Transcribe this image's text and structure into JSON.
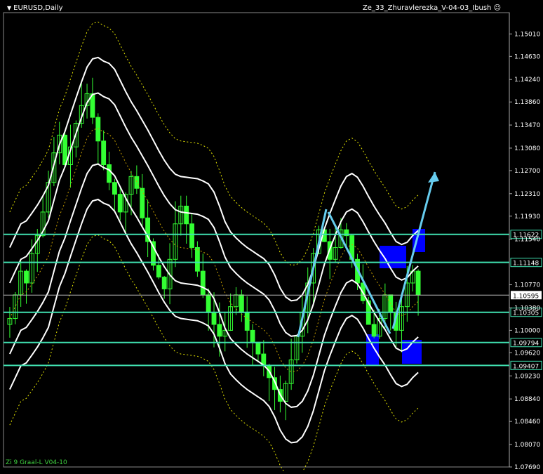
{
  "header": {
    "symbol": "EURUSD,Daily",
    "indicator_name": "Ze_33_Zhuravlerezka_V-04-03_Ibush"
  },
  "footer": {
    "label": "Zi 9 Graal-L V04-10"
  },
  "colors": {
    "background": "#000000",
    "candles": "#33ff33",
    "bands": "#ffffff",
    "level_lines": "#40e0b0",
    "arrows": "#66ccee",
    "zones": "#0000ff",
    "dotted_ma": "#e6e600"
  },
  "chart_data": {
    "type": "candlestick",
    "symbol": "EURUSD",
    "timeframe": "Daily",
    "y_axis": {
      "range": [
        1.0769,
        1.1537
      ],
      "ticks": [
        "1.15010",
        "1.14630",
        "1.14240",
        "1.13860",
        "1.13470",
        "1.13080",
        "1.12700",
        "1.12310",
        "1.11930",
        "1.11540",
        "1.11148",
        "1.10770",
        "1.10595",
        "1.10380",
        "1.10305",
        "1.10000",
        "1.09794",
        "1.09620",
        "1.09407",
        "1.09230",
        "1.08840",
        "1.08460",
        "1.08070",
        "1.07690"
      ]
    },
    "horizontal_levels": [
      {
        "value": 1.11622,
        "label": "1.11622"
      },
      {
        "value": 1.11148,
        "label": "1.11148"
      },
      {
        "value": 1.10305,
        "label": "1.10305"
      },
      {
        "value": 1.09794,
        "label": "1.09794"
      },
      {
        "value": 1.09407,
        "label": "1.09407"
      }
    ],
    "current_price": {
      "value": 1.10595,
      "label": "1.10595"
    },
    "approx_close_series": [
      1.102,
      1.106,
      1.11,
      1.108,
      1.113,
      1.116,
      1.12,
      1.125,
      1.13,
      1.133,
      1.128,
      1.131,
      1.135,
      1.138,
      1.14,
      1.136,
      1.132,
      1.128,
      1.125,
      1.123,
      1.12,
      1.123,
      1.126,
      1.124,
      1.119,
      1.115,
      1.111,
      1.109,
      1.107,
      1.112,
      1.118,
      1.121,
      1.118,
      1.114,
      1.11,
      1.106,
      1.103,
      1.101,
      1.099,
      1.1,
      1.104,
      1.106,
      1.103,
      1.1,
      1.098,
      1.096,
      1.094,
      1.092,
      1.09,
      1.088,
      1.091,
      1.095,
      1.099,
      1.103,
      1.108,
      1.113,
      1.117,
      1.115,
      1.112,
      1.114,
      1.117,
      1.116,
      1.112,
      1.108,
      1.105,
      1.101,
      1.099,
      1.102,
      1.106,
      1.103,
      1.1,
      1.104,
      1.108,
      1.11,
      1.106
    ]
  }
}
